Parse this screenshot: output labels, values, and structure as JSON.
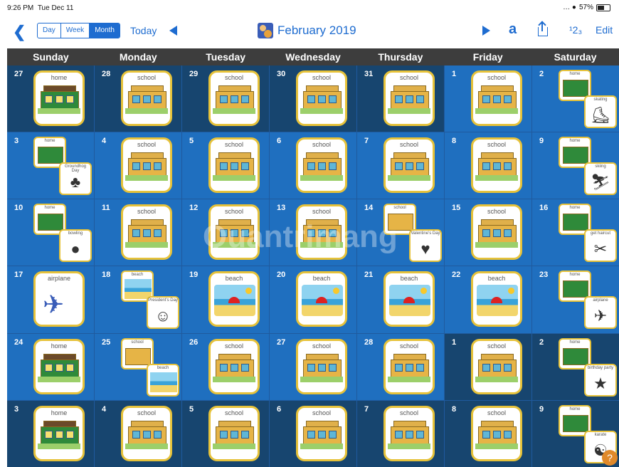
{
  "status_bar": {
    "time": "9:26 PM",
    "date": "Tue Dec 11",
    "wifi": "…. •",
    "battery": "57%"
  },
  "toolbar": {
    "back_icon": "chevron-left-icon",
    "views": [
      {
        "label": "Day"
      },
      {
        "label": "Week"
      },
      {
        "label": "Month",
        "selected": true
      }
    ],
    "today_label": "Today",
    "title": "February 2019",
    "numbering_label": "¹2₃",
    "edit_label": "Edit"
  },
  "weekdays": [
    "Sunday",
    "Monday",
    "Tuesday",
    "Wednesday",
    "Thursday",
    "Friday",
    "Saturday"
  ],
  "colors": {
    "accent": "#1e6cd0",
    "cell": "#1f6fbf",
    "cell_dim": "#17456f",
    "card_border": "#e6c23a",
    "header": "#3d3d3d"
  },
  "watermark": "Quantrimang",
  "weeks": [
    [
      {
        "day": "27",
        "dim": true,
        "items": [
          {
            "label": "home",
            "icon": "house-icon"
          }
        ]
      },
      {
        "day": "28",
        "dim": true,
        "items": [
          {
            "label": "school",
            "icon": "school-icon"
          }
        ]
      },
      {
        "day": "29",
        "dim": true,
        "items": [
          {
            "label": "school",
            "icon": "school-icon"
          }
        ]
      },
      {
        "day": "30",
        "dim": true,
        "items": [
          {
            "label": "school",
            "icon": "school-icon"
          }
        ]
      },
      {
        "day": "31",
        "dim": true,
        "items": [
          {
            "label": "school",
            "icon": "school-icon"
          }
        ]
      },
      {
        "day": "1",
        "items": [
          {
            "label": "school",
            "icon": "school-icon"
          }
        ]
      },
      {
        "day": "2",
        "items": [
          {
            "label": "home",
            "icon": "house-icon"
          },
          {
            "label": "skating",
            "icon": "ice-skate-icon"
          }
        ]
      }
    ],
    [
      {
        "day": "3",
        "items": [
          {
            "label": "home",
            "icon": "house-icon"
          },
          {
            "label": "Groundhog Day",
            "icon": "groundhog-icon"
          }
        ]
      },
      {
        "day": "4",
        "items": [
          {
            "label": "school",
            "icon": "school-icon"
          }
        ]
      },
      {
        "day": "5",
        "items": [
          {
            "label": "school",
            "icon": "school-icon"
          }
        ]
      },
      {
        "day": "6",
        "items": [
          {
            "label": "school",
            "icon": "school-icon"
          }
        ]
      },
      {
        "day": "7",
        "items": [
          {
            "label": "school",
            "icon": "school-icon"
          }
        ]
      },
      {
        "day": "8",
        "items": [
          {
            "label": "school",
            "icon": "school-icon"
          }
        ]
      },
      {
        "day": "9",
        "items": [
          {
            "label": "home",
            "icon": "house-icon"
          },
          {
            "label": "skiing",
            "icon": "skier-icon"
          }
        ]
      }
    ],
    [
      {
        "day": "10",
        "items": [
          {
            "label": "home",
            "icon": "house-icon"
          },
          {
            "label": "bowling",
            "icon": "bowling-icon"
          }
        ]
      },
      {
        "day": "11",
        "items": [
          {
            "label": "school",
            "icon": "school-icon"
          }
        ]
      },
      {
        "day": "12",
        "items": [
          {
            "label": "school",
            "icon": "school-icon"
          }
        ]
      },
      {
        "day": "13",
        "items": [
          {
            "label": "school",
            "icon": "school-icon"
          }
        ]
      },
      {
        "day": "14",
        "items": [
          {
            "label": "school",
            "icon": "school-icon"
          },
          {
            "label": "Valentine's Day",
            "icon": "cupid-icon"
          }
        ]
      },
      {
        "day": "15",
        "items": [
          {
            "label": "school",
            "icon": "school-icon"
          }
        ]
      },
      {
        "day": "16",
        "items": [
          {
            "label": "home",
            "icon": "house-icon"
          },
          {
            "label": "get haircut",
            "icon": "haircut-icon"
          }
        ]
      }
    ],
    [
      {
        "day": "17",
        "items": [
          {
            "label": "airplane",
            "icon": "airplane-icon"
          }
        ]
      },
      {
        "day": "18",
        "items": [
          {
            "label": "beach",
            "icon": "beach-icon"
          },
          {
            "label": "President's Day",
            "icon": "presidents-icon"
          }
        ]
      },
      {
        "day": "19",
        "items": [
          {
            "label": "beach",
            "icon": "beach-icon"
          }
        ]
      },
      {
        "day": "20",
        "items": [
          {
            "label": "beach",
            "icon": "beach-icon"
          }
        ]
      },
      {
        "day": "21",
        "items": [
          {
            "label": "beach",
            "icon": "beach-icon"
          }
        ]
      },
      {
        "day": "22",
        "items": [
          {
            "label": "beach",
            "icon": "beach-icon"
          }
        ]
      },
      {
        "day": "23",
        "items": [
          {
            "label": "home",
            "icon": "house-icon"
          },
          {
            "label": "airplane",
            "icon": "airplane-icon"
          }
        ]
      }
    ],
    [
      {
        "day": "24",
        "items": [
          {
            "label": "home",
            "icon": "house-icon"
          }
        ]
      },
      {
        "day": "25",
        "items": [
          {
            "label": "school",
            "icon": "school-icon"
          },
          {
            "label": "beach",
            "icon": "beach-icon"
          }
        ]
      },
      {
        "day": "26",
        "items": [
          {
            "label": "school",
            "icon": "school-icon"
          }
        ]
      },
      {
        "day": "27",
        "items": [
          {
            "label": "school",
            "icon": "school-icon"
          }
        ]
      },
      {
        "day": "28",
        "items": [
          {
            "label": "school",
            "icon": "school-icon"
          }
        ]
      },
      {
        "day": "1",
        "dim": true,
        "items": [
          {
            "label": "school",
            "icon": "school-icon"
          }
        ]
      },
      {
        "day": "2",
        "dim": true,
        "items": [
          {
            "label": "home",
            "icon": "house-icon"
          },
          {
            "label": "birthday party",
            "icon": "party-icon"
          }
        ]
      }
    ],
    [
      {
        "day": "3",
        "dim": true,
        "items": [
          {
            "label": "home",
            "icon": "house-icon"
          }
        ]
      },
      {
        "day": "4",
        "dim": true,
        "items": [
          {
            "label": "school",
            "icon": "school-icon"
          }
        ]
      },
      {
        "day": "5",
        "dim": true,
        "items": [
          {
            "label": "school",
            "icon": "school-icon"
          }
        ]
      },
      {
        "day": "6",
        "dim": true,
        "items": [
          {
            "label": "school",
            "icon": "school-icon"
          }
        ]
      },
      {
        "day": "7",
        "dim": true,
        "items": [
          {
            "label": "school",
            "icon": "school-icon"
          }
        ]
      },
      {
        "day": "8",
        "dim": true,
        "items": [
          {
            "label": "school",
            "icon": "school-icon"
          }
        ]
      },
      {
        "day": "9",
        "dim": true,
        "items": [
          {
            "label": "home",
            "icon": "house-icon"
          },
          {
            "label": "karate",
            "icon": "karate-icon"
          }
        ]
      }
    ]
  ],
  "help_icon": "help-icon"
}
